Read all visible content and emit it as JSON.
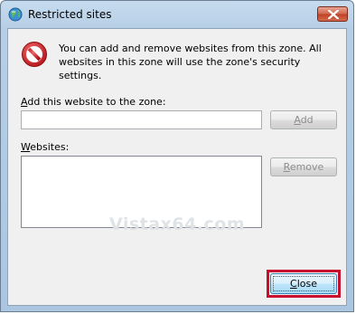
{
  "window": {
    "title": "Restricted sites",
    "title_icon": "globe-icon",
    "close_icon": "close-icon"
  },
  "info": {
    "icon": "no-entry-icon",
    "text": "You can add and remove websites from this zone. All websites in this zone will use the zone's security settings."
  },
  "add_section": {
    "label_accel": "A",
    "label_rest": "dd this website to the zone:",
    "input_value": "",
    "add_button_accel": "A",
    "add_button_rest": "dd"
  },
  "websites_section": {
    "label_accel": "W",
    "label_rest": "ebsites:",
    "items": [],
    "remove_button_accel": "R",
    "remove_button_rest": "emove"
  },
  "watermark": "Vistax64.com",
  "footer": {
    "close_button_accel": "C",
    "close_button_rest": "lose"
  },
  "colors": {
    "highlight_border": "#c8102e",
    "close_x_red": "#c0432a"
  }
}
